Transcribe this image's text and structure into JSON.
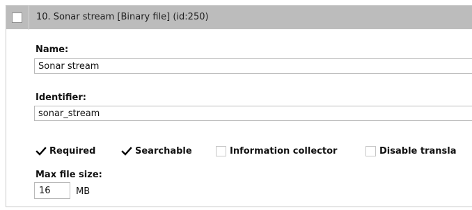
{
  "attribute": {
    "header_title": "10. Sonar stream [Binary file] (id:250)",
    "name_label": "Name:",
    "name_value": "Sonar stream",
    "identifier_label": "Identifier:",
    "identifier_value": "sonar_stream",
    "options": [
      {
        "label": "Required",
        "checked": true
      },
      {
        "label": "Searchable",
        "checked": true
      },
      {
        "label": "Information collector",
        "checked": false
      },
      {
        "label": "Disable transla",
        "checked": false
      }
    ],
    "max_file_size_label": "Max file size:",
    "max_file_size_value": "16",
    "max_file_size_unit": "MB"
  },
  "colors": {
    "header_bg": "#bcbcbc",
    "check_color": "#000000",
    "border": "#b9b9b9"
  },
  "icons": {
    "checked": "checkmark-icon"
  }
}
